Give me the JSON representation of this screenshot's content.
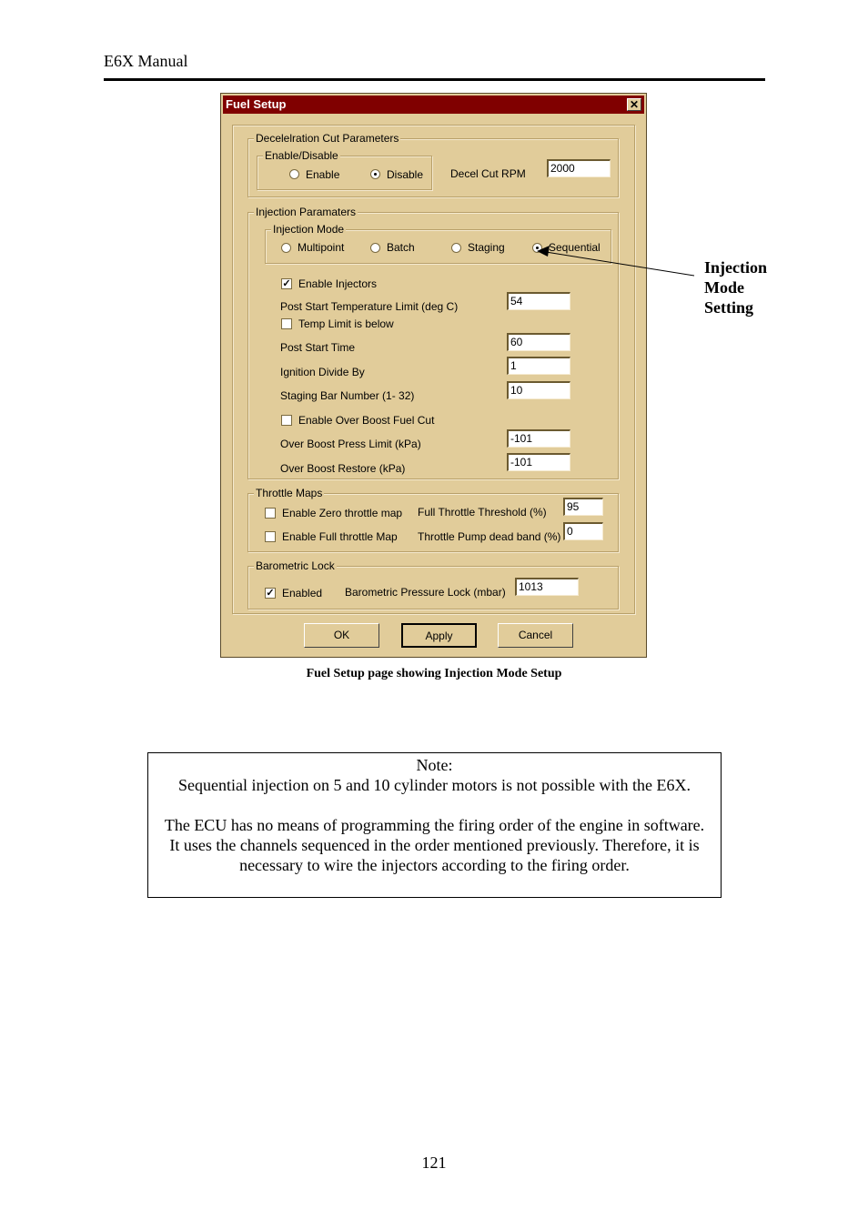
{
  "page": {
    "header": "E6X Manual",
    "page_number": "121",
    "caption": "Fuel Setup page showing Injection Mode Setup",
    "callout": [
      "Injection",
      "Mode",
      "Setting"
    ]
  },
  "dialog": {
    "title": "Fuel Setup",
    "close_icon": "close-x-icon",
    "decel": {
      "group_label": "Decelelration Cut Parameters",
      "enable_group_label": "Enable/Disable",
      "options": [
        {
          "label": "Enable",
          "selected": false
        },
        {
          "label": "Disable",
          "selected": true
        }
      ],
      "rpm_label": "Decel Cut RPM",
      "rpm_value": "2000"
    },
    "injection": {
      "group_label": "Injection Paramaters",
      "mode_group_label": "Injection Mode",
      "modes": [
        {
          "label": "Multipoint",
          "selected": false
        },
        {
          "label": "Batch",
          "selected": false
        },
        {
          "label": "Staging",
          "selected": false
        },
        {
          "label": "Sequential",
          "selected": true
        }
      ],
      "enable_injectors_label": "Enable Injectors",
      "enable_injectors_checked": true,
      "post_start_temp_label": "Post Start Temperature Limit (deg C)",
      "post_start_temp_value": "54",
      "temp_limit_below_label": "Temp Limit is below",
      "temp_limit_below_checked": false,
      "post_start_time_label": "Post Start Time",
      "post_start_time_value": "60",
      "ignition_divide_label": "Ignition Divide By",
      "ignition_divide_value": "1",
      "staging_bar_label": "Staging Bar Number (1- 32)",
      "staging_bar_value": "10",
      "over_boost_cut_label": "Enable Over Boost Fuel Cut",
      "over_boost_cut_checked": false,
      "over_boost_limit_label": "Over Boost Press Limit (kPa)",
      "over_boost_limit_value": "-101",
      "over_boost_restore_label": "Over Boost Restore (kPa)",
      "over_boost_restore_value": "-101"
    },
    "throttle": {
      "group_label": "Throttle Maps",
      "zero_map_label": "Enable Zero throttle map",
      "zero_map_checked": false,
      "full_map_label": "Enable Full throttle Map",
      "full_map_checked": false,
      "full_threshold_label": "Full Throttle Threshold (%)",
      "full_threshold_value": "95",
      "pump_deadband_label": "Throttle Pump dead band (%)",
      "pump_deadband_value": "0"
    },
    "baro": {
      "group_label": "Barometric Lock",
      "enabled_label": "Enabled",
      "enabled_checked": true,
      "lock_label": "Barometric Pressure Lock (mbar)",
      "lock_value": "1013"
    },
    "buttons": {
      "ok": "OK",
      "apply": "Apply",
      "cancel": "Cancel"
    }
  },
  "note": {
    "title": "Note:",
    "line1": "Sequential injection on 5 and 10 cylinder motors is not possible with the E6X.",
    "para2": "The ECU has no means of programming the firing order of the engine in software. It uses the channels sequenced in the order mentioned previously. Therefore, it is necessary to wire the injectors according to the firing order."
  },
  "colors": {
    "titlebar": "#800000",
    "dialog_bg": "#e1cc9a"
  }
}
